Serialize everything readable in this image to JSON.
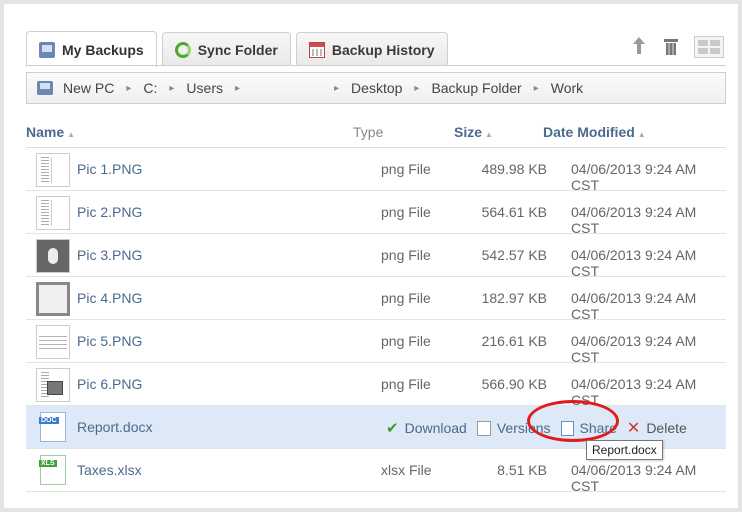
{
  "tabs": [
    {
      "label": "My Backups",
      "icon": "computer-icon",
      "active": true
    },
    {
      "label": "Sync Folder",
      "icon": "sync-icon",
      "active": false
    },
    {
      "label": "Backup History",
      "icon": "calendar-icon",
      "active": false
    }
  ],
  "breadcrumb": [
    "New PC",
    "C:",
    "Users",
    "",
    "Desktop",
    "Backup Folder",
    "Work"
  ],
  "columns": {
    "name": "Name",
    "type": "Type",
    "size": "Size",
    "date": "Date Modified"
  },
  "files": [
    {
      "name": "Pic 1.PNG",
      "type": "png File",
      "size": "489.98 KB",
      "date": "04/06/2013 9:24 AM CST",
      "thumb": "vert"
    },
    {
      "name": "Pic 2.PNG",
      "type": "png File",
      "size": "564.61 KB",
      "date": "04/06/2013 9:24 AM CST",
      "thumb": "vert"
    },
    {
      "name": "Pic 3.PNG",
      "type": "png File",
      "size": "542.57 KB",
      "date": "04/06/2013 9:24 AM CST",
      "thumb": "dark"
    },
    {
      "name": "Pic 4.PNG",
      "type": "png File",
      "size": "182.97 KB",
      "date": "04/06/2013 9:24 AM CST",
      "thumb": "frame"
    },
    {
      "name": "Pic 5.PNG",
      "type": "png File",
      "size": "216.61 KB",
      "date": "04/06/2013 9:24 AM CST",
      "thumb": "lines"
    },
    {
      "name": "Pic 6.PNG",
      "type": "png File",
      "size": "566.90 KB",
      "date": "04/06/2013 9:24 AM CST",
      "thumb": "box"
    }
  ],
  "selected_file": {
    "name": "Report.docx",
    "icon_label": "DOC"
  },
  "actions": {
    "download": "Download",
    "versions": "Versions",
    "share": "Share",
    "delete": "Delete"
  },
  "tooltip": "Report.docx",
  "last_file": {
    "name": "Taxes.xlsx",
    "type": "xlsx File",
    "size": "8.51 KB",
    "date": "04/06/2013 9:24 AM CST",
    "icon_label": "XLS"
  },
  "colors": {
    "link": "#4b6a8e",
    "selected_row": "#dde9f6",
    "highlight": "#e11b1b"
  }
}
